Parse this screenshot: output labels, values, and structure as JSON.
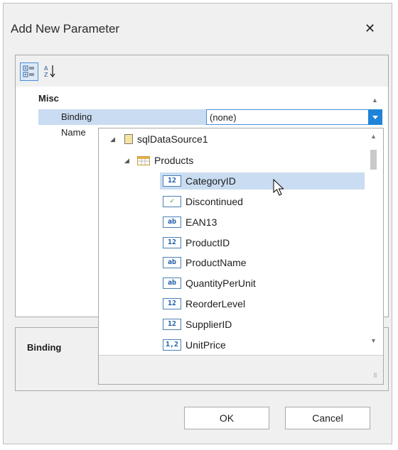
{
  "dialog": {
    "title": "Add New Parameter",
    "close_icon": "close-icon"
  },
  "toolbar": {
    "categorized_icon": "categorized-view-icon",
    "alphabetical_icon": "sort-alphabetical-icon"
  },
  "grid": {
    "category": "Misc",
    "rows": [
      {
        "name": "Binding",
        "value": "(none)"
      },
      {
        "name": "Name",
        "value": ""
      }
    ]
  },
  "description": {
    "title": "Binding"
  },
  "tree": {
    "datasource": "sqlDataSource1",
    "table": "Products",
    "fields": [
      {
        "label": "CategoryID",
        "type": "12"
      },
      {
        "label": "Discontinued",
        "type": "✓"
      },
      {
        "label": "EAN13",
        "type": "ab"
      },
      {
        "label": "ProductID",
        "type": "12"
      },
      {
        "label": "ProductName",
        "type": "ab"
      },
      {
        "label": "QuantityPerUnit",
        "type": "ab"
      },
      {
        "label": "ReorderLevel",
        "type": "12"
      },
      {
        "label": "SupplierID",
        "type": "12"
      },
      {
        "label": "UnitPrice",
        "type": "1,2"
      }
    ]
  },
  "buttons": {
    "ok": "OK",
    "cancel": "Cancel"
  },
  "colors": {
    "selection": "#c9dcf1",
    "accent": "#1f84d8"
  }
}
